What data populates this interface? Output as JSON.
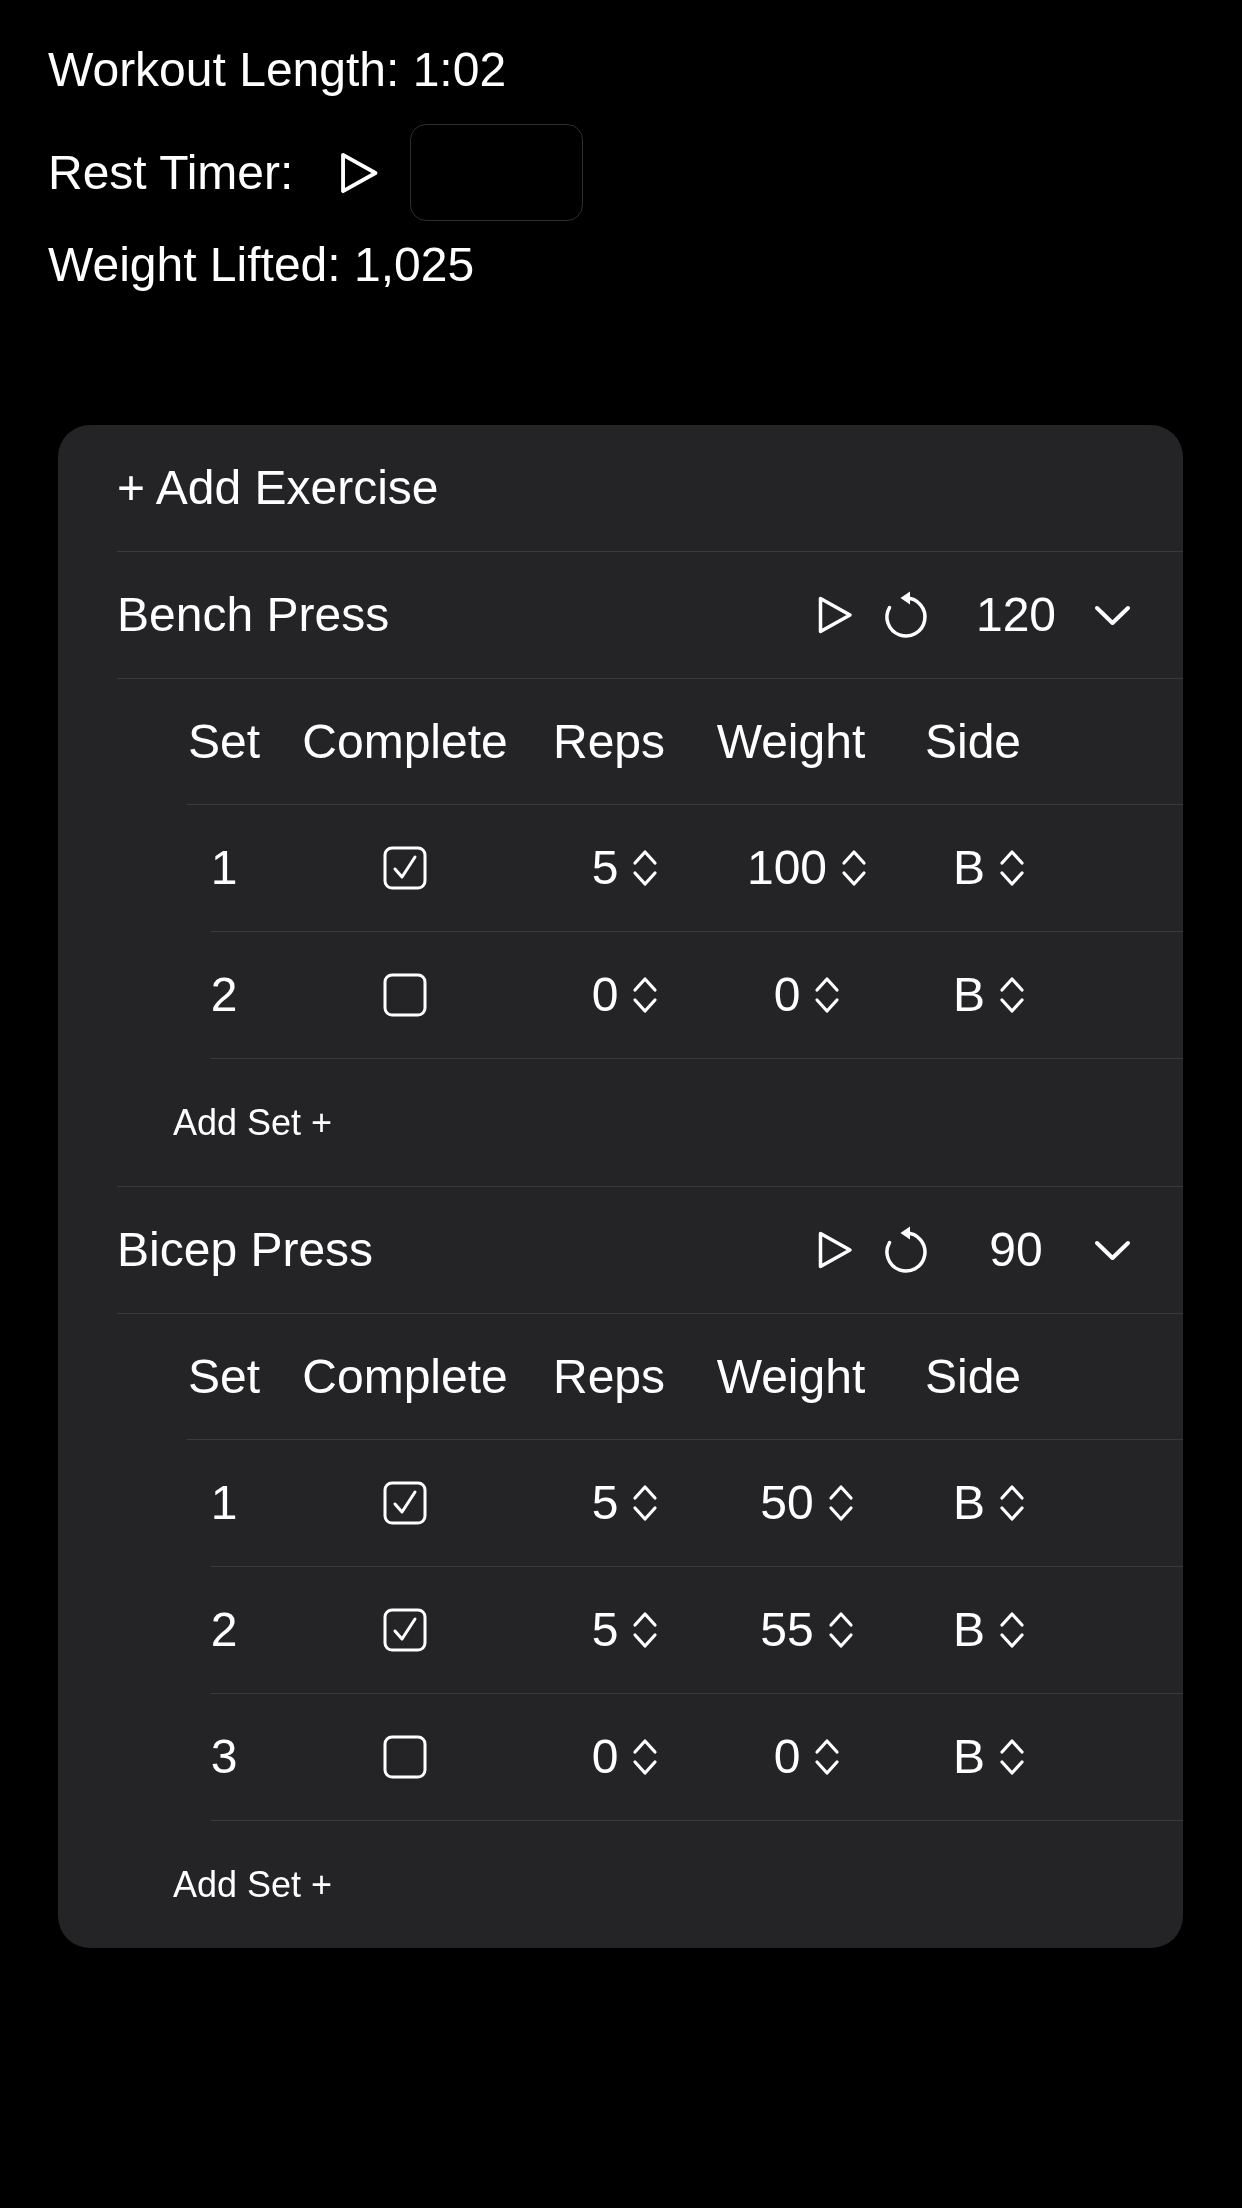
{
  "summary": {
    "workout_length": "Workout Length: 1:02",
    "rest_timer_label": "Rest Timer:",
    "weight_lifted": "Weight Lifted: 1,025"
  },
  "add_exercise": "+ Add Exercise",
  "exercises": [
    {
      "name": "Bench Press",
      "rest": "120",
      "expanded": true,
      "columns": [
        "Set",
        "Complete",
        "Reps",
        "Weight",
        "Side"
      ],
      "sets": [
        {
          "set": "1",
          "complete": true,
          "reps": "5",
          "weight": "100",
          "side": "B"
        },
        {
          "set": "2",
          "complete": false,
          "reps": "0",
          "weight": "0",
          "side": "B"
        }
      ],
      "add_set": "Add Set +"
    },
    {
      "name": "Bicep Press",
      "rest": "90",
      "expanded": true,
      "columns": [
        "Set",
        "Complete",
        "Reps",
        "Weight",
        "Side"
      ],
      "sets": [
        {
          "set": "1",
          "complete": true,
          "reps": "5",
          "weight": "50",
          "side": "B"
        },
        {
          "set": "2",
          "complete": true,
          "reps": "5",
          "weight": "55",
          "side": "B"
        },
        {
          "set": "3",
          "complete": false,
          "reps": "0",
          "weight": "0",
          "side": "B"
        }
      ],
      "add_set": "Add Set +"
    }
  ]
}
